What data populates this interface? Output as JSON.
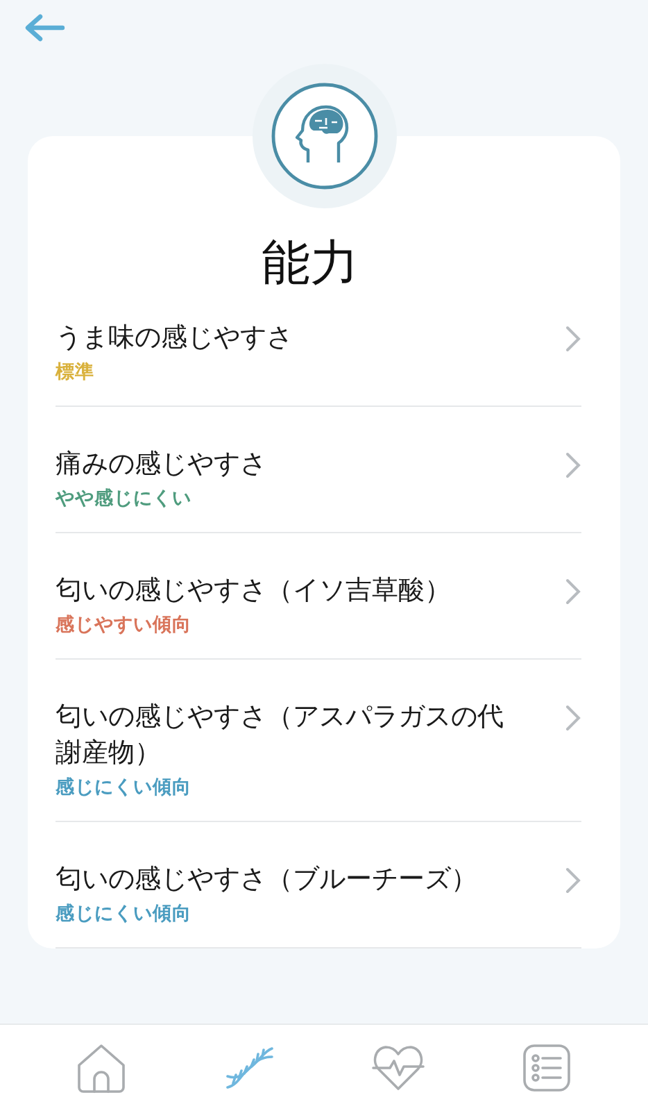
{
  "title": "能力",
  "items": [
    {
      "name": "うま味の感じやすさ",
      "result": "標準",
      "color": "#d9b13c"
    },
    {
      "name": "痛みの感じやすさ",
      "result": "やや感じにくい",
      "color": "#4f9c7e"
    },
    {
      "name": "匂いの感じやすさ（イソ吉草酸）",
      "result": "感じやすい傾向",
      "color": "#d9745a"
    },
    {
      "name": "匂いの感じやすさ（アスパラガスの代謝産物）",
      "result": "感じにくい傾向",
      "color": "#4a9cc0"
    },
    {
      "name": "匂いの感じやすさ（ブルーチーズ）",
      "result": "感じにくい傾向",
      "color": "#4a9cc0"
    }
  ],
  "tabs": [
    {
      "kind": "home",
      "selected": false
    },
    {
      "kind": "dna",
      "selected": true
    },
    {
      "kind": "heart",
      "selected": false
    },
    {
      "kind": "list",
      "selected": false
    }
  ]
}
